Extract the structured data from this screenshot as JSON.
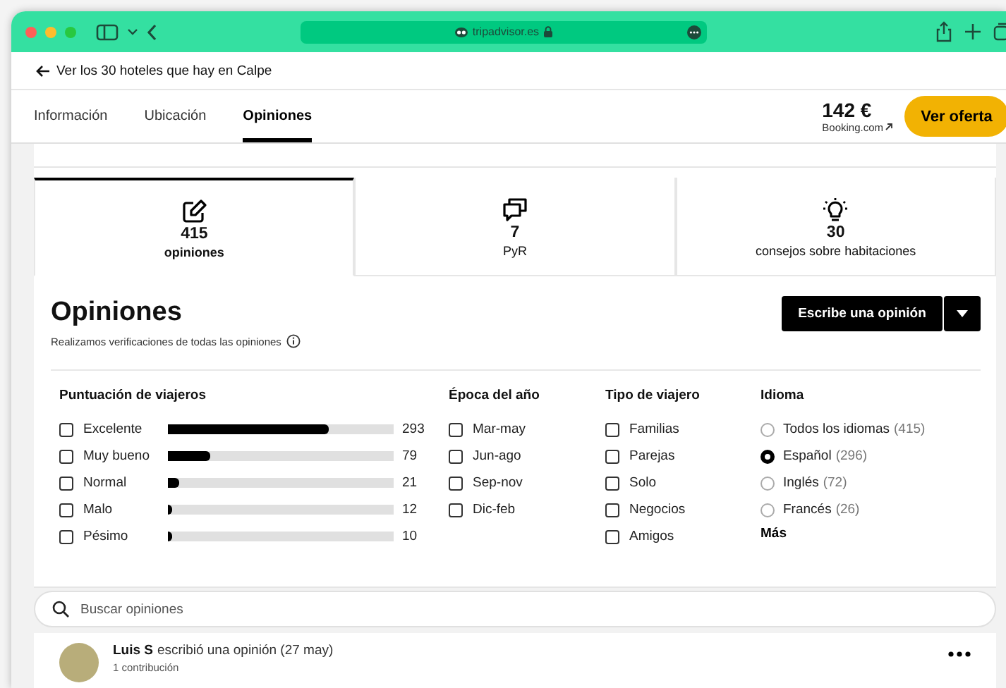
{
  "browser": {
    "url": "tripadvisor.es"
  },
  "back_link": "Ver los 30 hoteles que hay en Calpe",
  "nav_tabs": [
    {
      "label": "Información",
      "selected": false
    },
    {
      "label": "Ubicación",
      "selected": false
    },
    {
      "label": "Opiniones",
      "selected": true
    }
  ],
  "offer": {
    "price": "142 €",
    "provider": "Booking.com",
    "button": "Ver oferta"
  },
  "summary_tabs": [
    {
      "kind": "reviews",
      "count": "415",
      "label": "opiniones",
      "selected": true
    },
    {
      "kind": "qa",
      "count": "7",
      "label": "PyR",
      "selected": false
    },
    {
      "kind": "tips",
      "count": "30",
      "label": "consejos sobre habitaciones",
      "selected": false
    }
  ],
  "reviews_header": {
    "title": "Opiniones",
    "note": "Realizamos verificaciones de todas las opiniones",
    "write_button": "Escribe una opinión"
  },
  "rating_filter": {
    "title": "Puntuación de viajeros",
    "items": [
      {
        "label": "Excelente",
        "checked": false,
        "level": 0.71,
        "count": "293"
      },
      {
        "label": "Muy bueno",
        "checked": false,
        "level": 0.19,
        "count": "79"
      },
      {
        "label": "Normal",
        "checked": false,
        "level": 0.05,
        "count": "21"
      },
      {
        "label": "Malo",
        "checked": false,
        "level": 0.02,
        "count": "12"
      },
      {
        "label": "Pésimo",
        "checked": false,
        "level": 0.02,
        "count": "10"
      }
    ]
  },
  "season_filter": {
    "title": "Época del año",
    "items": [
      {
        "label": "Mar-may",
        "checked": false
      },
      {
        "label": "Jun-ago",
        "checked": false
      },
      {
        "label": "Sep-nov",
        "checked": false
      },
      {
        "label": "Dic-feb",
        "checked": false
      }
    ]
  },
  "traveler_filter": {
    "title": "Tipo de viajero",
    "items": [
      {
        "label": "Familias",
        "checked": false
      },
      {
        "label": "Parejas",
        "checked": false
      },
      {
        "label": "Solo",
        "checked": false
      },
      {
        "label": "Negocios",
        "checked": false
      },
      {
        "label": "Amigos",
        "checked": false
      }
    ]
  },
  "language_filter": {
    "title": "Idioma",
    "items": [
      {
        "label": "Todos los idiomas",
        "count": "(415)",
        "selected": false
      },
      {
        "label": "Español",
        "count": "(296)",
        "selected": true
      },
      {
        "label": "Inglés",
        "count": "(72)",
        "selected": false
      },
      {
        "label": "Francés",
        "count": "(26)",
        "selected": false
      }
    ],
    "more": "Más"
  },
  "search": {
    "placeholder": "Buscar opiniones"
  },
  "review": {
    "author": "Luis S",
    "action": "escribió una opinión (27 may)",
    "contributions": "1 contribución"
  }
}
